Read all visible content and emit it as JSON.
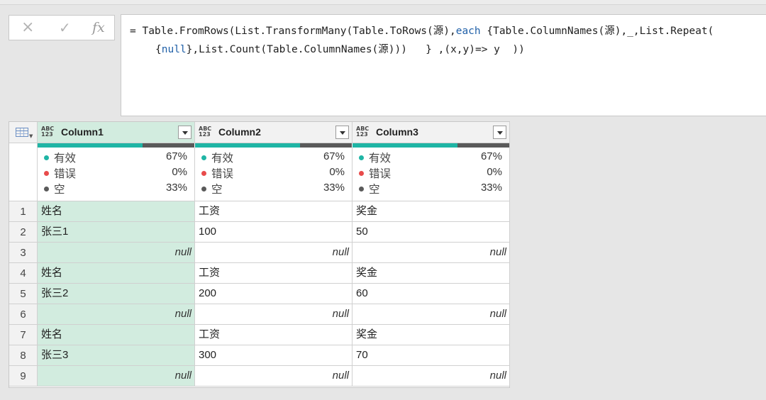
{
  "formula_bar": {
    "cancel_icon": "×",
    "commit_icon": "✓",
    "fx_label": "fx",
    "line1_a": "= Table.FromRows(List.TransformMany(Table.ToRows(源),",
    "line1_kw": "each",
    "line1_b": " {Table.ColumnNames(源),_,List.Repeat(",
    "line2_a": "{",
    "line2_kw": "null",
    "line2_b": "},List.Count(Table.ColumnNames(源)))   } ,(x,y)=> y  ))"
  },
  "colors": {
    "valid": "#1fb5a5",
    "error": "#e84b4b",
    "empty": "#5a5a5a",
    "selected": "#d2ecdf"
  },
  "columns": [
    {
      "name": "Column1",
      "type_top": "ABC",
      "type_bottom": "123",
      "selected": true,
      "profile": {
        "valid_label": "有效",
        "valid_pct": "67%",
        "error_label": "错误",
        "error_pct": "0%",
        "empty_label": "空",
        "empty_pct": "33%"
      }
    },
    {
      "name": "Column2",
      "type_top": "ABC",
      "type_bottom": "123",
      "selected": false,
      "profile": {
        "valid_label": "有效",
        "valid_pct": "67%",
        "error_label": "错误",
        "error_pct": "0%",
        "empty_label": "空",
        "empty_pct": "33%"
      }
    },
    {
      "name": "Column3",
      "type_top": "ABC",
      "type_bottom": "123",
      "selected": false,
      "profile": {
        "valid_label": "有效",
        "valid_pct": "67%",
        "error_label": "错误",
        "error_pct": "0%",
        "empty_label": "空",
        "empty_pct": "33%"
      }
    }
  ],
  "quality_fraction": {
    "valid": 0.67,
    "empty": 0.33
  },
  "rows": [
    {
      "n": "1",
      "cells": [
        "姓名",
        "工资",
        "奖金"
      ]
    },
    {
      "n": "2",
      "cells": [
        "张三1",
        "100",
        "50"
      ]
    },
    {
      "n": "3",
      "cells": [
        "null",
        "null",
        "null"
      ]
    },
    {
      "n": "4",
      "cells": [
        "姓名",
        "工资",
        "奖金"
      ]
    },
    {
      "n": "5",
      "cells": [
        "张三2",
        "200",
        "60"
      ]
    },
    {
      "n": "6",
      "cells": [
        "null",
        "null",
        "null"
      ]
    },
    {
      "n": "7",
      "cells": [
        "姓名",
        "工资",
        "奖金"
      ]
    },
    {
      "n": "8",
      "cells": [
        "张三3",
        "300",
        "70"
      ]
    },
    {
      "n": "9",
      "cells": [
        "null",
        "null",
        "null"
      ]
    }
  ]
}
